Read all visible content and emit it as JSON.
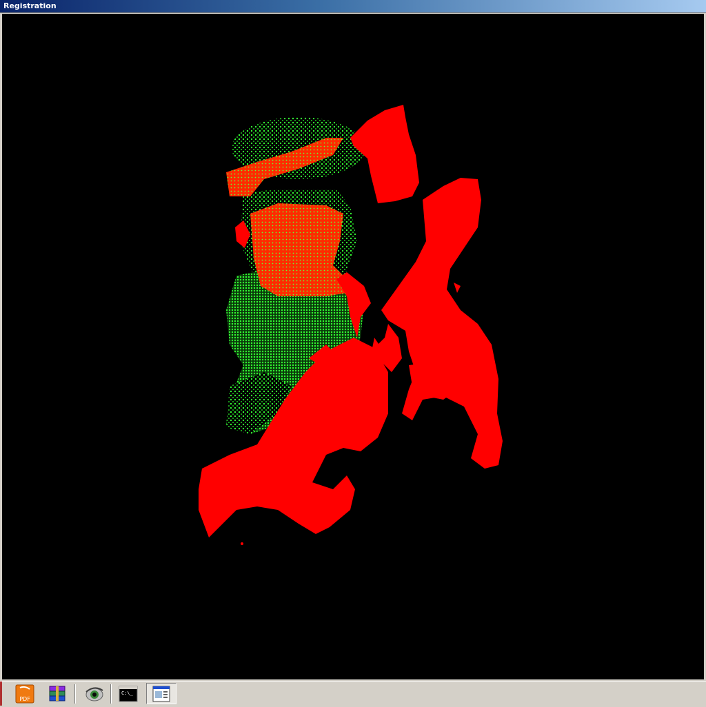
{
  "window": {
    "title": "Registration"
  },
  "viewport": {
    "background": "#000000",
    "source_cloud_color": "#33ff33",
    "target_cloud_color": "#ff0000"
  },
  "taskbar": {
    "items": [
      {
        "icon": "foxit-pdf-icon",
        "label": "PDF"
      },
      {
        "icon": "winrar-icon"
      },
      {
        "icon": "eye-viewer-icon"
      },
      {
        "icon": "command-prompt-icon",
        "label": "C:\\_"
      },
      {
        "icon": "window-app-icon",
        "pressed": true
      }
    ]
  }
}
